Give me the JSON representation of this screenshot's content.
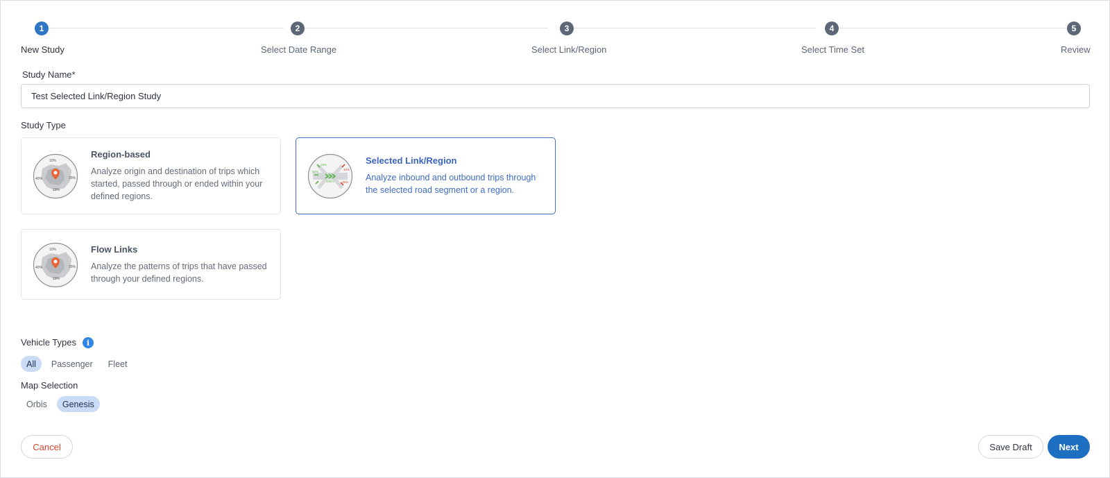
{
  "stepper": {
    "steps": [
      {
        "number": "1",
        "label": "New Study"
      },
      {
        "number": "2",
        "label": "Select Date Range"
      },
      {
        "number": "3",
        "label": "Select Link/Region"
      },
      {
        "number": "4",
        "label": "Select Time Set"
      },
      {
        "number": "5",
        "label": "Review"
      }
    ],
    "active_step": 1
  },
  "study_name": {
    "label": "Study Name*",
    "value": "Test Selected Link/Region Study"
  },
  "study_type": {
    "label": "Study Type",
    "selected": "Selected Link/Region",
    "options": [
      {
        "title": "Region-based",
        "description": "Analyze origin and destination of trips which started, passed through or ended within your defined regions.",
        "icon": "region-map-icon",
        "thumb_labels": [
          "10%",
          "40%",
          "35%",
          "15%"
        ]
      },
      {
        "title": "Selected Link/Region",
        "description": "Analyze inbound and outbound trips through the selected road segment or a region.",
        "icon": "link-flow-icon",
        "thumb_labels": [
          "15%",
          "50%",
          "10%",
          "100%",
          "15%"
        ]
      },
      {
        "title": "Flow Links",
        "description": "Analyze the patterns of trips that have passed through your defined regions.",
        "icon": "region-map-icon",
        "thumb_labels": [
          "10%",
          "40%",
          "35%",
          "15%"
        ]
      }
    ]
  },
  "vehicle_types": {
    "label": "Vehicle Types",
    "info_icon": "i",
    "options": [
      "All",
      "Passenger",
      "Fleet"
    ],
    "selected": "All"
  },
  "map_selection": {
    "label": "Map Selection",
    "options": [
      "Orbis",
      "Genesis"
    ],
    "selected": "Genesis"
  },
  "actions": {
    "cancel": "Cancel",
    "save_draft": "Save Draft",
    "next": "Next"
  },
  "colors": {
    "primary": "#1e6fc2",
    "active_step": "#2f76c4",
    "inactive_step": "#5d6778",
    "cancel_text": "#d8412e",
    "selected_pill": "#c9dbf5",
    "selected_card_border": "#3e6fc4"
  }
}
